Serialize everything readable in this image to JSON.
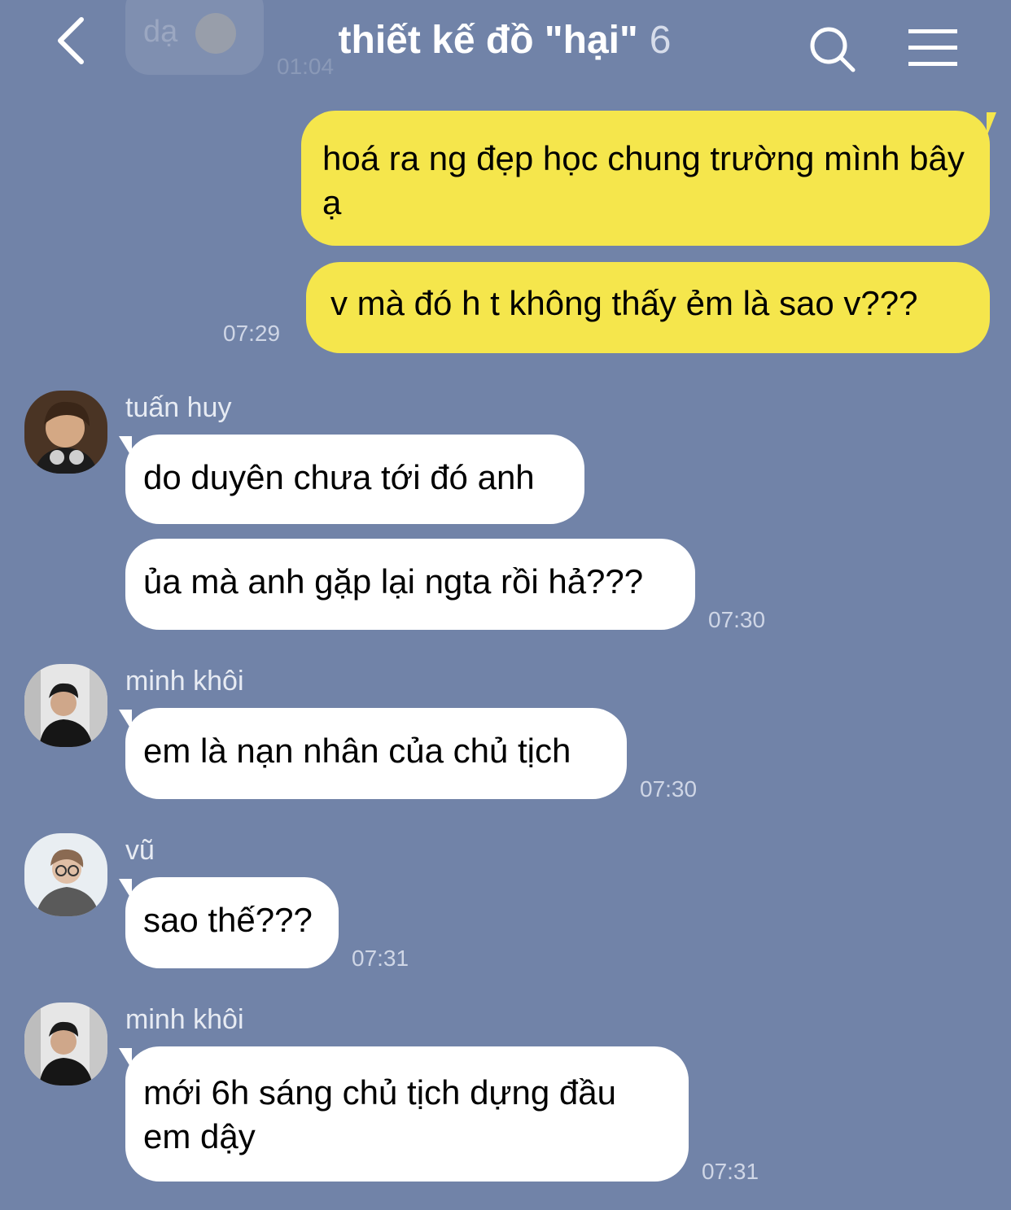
{
  "header": {
    "title": "thiết kế đồ \"hại\"",
    "member_count": "6"
  },
  "previous_message": {
    "text": "dạ",
    "time": "01:04"
  },
  "messages": [
    {
      "type": "outgoing",
      "text": "hoá ra ng đẹp học chung trường mình bây ạ"
    },
    {
      "type": "outgoing",
      "text": "v mà đó h t không thấy ẻm là sao v???",
      "time": "07:29"
    },
    {
      "type": "incoming",
      "sender": "tuấn huy",
      "text": "do duyên chưa tới đó anh"
    },
    {
      "type": "incoming",
      "text": "ủa mà anh gặp lại ngta rồi hả???",
      "time": "07:30"
    },
    {
      "type": "incoming",
      "sender": "minh khôi",
      "text": "em là nạn nhân của chủ tịch",
      "time": "07:30"
    },
    {
      "type": "incoming",
      "sender": "vũ",
      "text": "sao thế???",
      "time": "07:31"
    },
    {
      "type": "incoming",
      "sender": "minh khôi",
      "text": "mới 6h sáng chủ tịch dựng đầu em dậy",
      "time": "07:31"
    }
  ],
  "colors": {
    "background": "#7183a8",
    "outgoing_bubble": "#f5e64c",
    "incoming_bubble": "#ffffff",
    "timestamp": "#cfd6e6"
  },
  "icons": {
    "back": "chevron-left-icon",
    "search": "search-icon",
    "menu": "hamburger-menu-icon"
  }
}
